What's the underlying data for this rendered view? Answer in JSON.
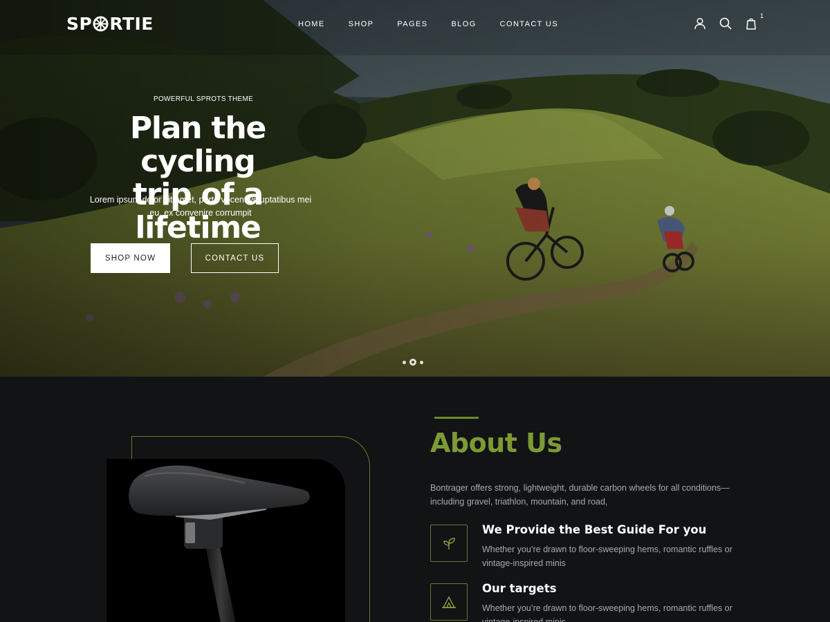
{
  "brand": {
    "logo_text_left": "SP",
    "logo_text_right": "RTIE"
  },
  "nav": {
    "items": [
      "HOME",
      "SHOP",
      "PAGES",
      "BLOG",
      "CONTACT US"
    ],
    "cart_count": "1"
  },
  "hero": {
    "eyebrow": "POWERFUL SPROTS THEME",
    "title_line1": "Plan the cycling",
    "title_line2": "trip of a lifetime",
    "text": "Lorem ipsum dolor sit amet, purto vocent voluptatibus mei eu, ex convenire corrumpit",
    "shop_button": "SHOP NOW",
    "contact_button": "CONTACT US",
    "slides": 3,
    "active_slide": 2
  },
  "about": {
    "title": "About Us",
    "description": "Bontrager offers strong, lightweight, durable carbon wheels for all conditions—including gravel, triathlon, mountain, and road,",
    "features": [
      {
        "title": "We Provide the Best Guide For you",
        "text": "Whether you’re drawn to floor-sweeping hems, romantic ruffles or vintage-inspired minis",
        "icon": "sprout-icon"
      },
      {
        "title": "Our targets",
        "text": "Whether you’re drawn to floor-sweeping hems, romantic ruffles or vintage-inspired minis",
        "icon": "tent-icon"
      }
    ]
  },
  "colors": {
    "accent": "#7d9a34",
    "dark_bg": "#111315"
  }
}
